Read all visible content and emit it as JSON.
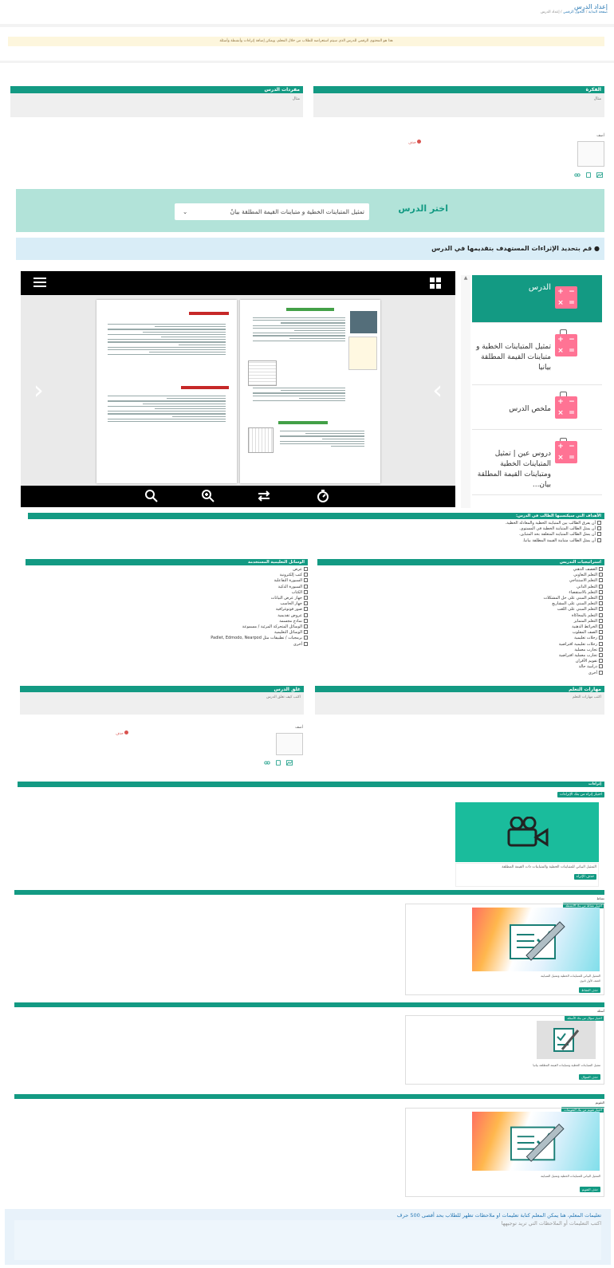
{
  "header": {
    "title": "إعداد الدرس",
    "breadcrumb": [
      "صفحة البداية",
      "التحول الرقمي",
      "إعداد الدرس"
    ]
  },
  "notice": {
    "text": "هذا هو المحتوى الرقمي للدرس الذي سيتم استعراضه للطلاب من خلال المعلم، ويمكن إضافة إثراءات وأنشطة وأسئلة"
  },
  "panels_top": {
    "left": {
      "title": "مفردات الدرس",
      "placeholder": "مثال"
    },
    "right": {
      "title": "الفكرة",
      "placeholder": "مثال"
    }
  },
  "attachment_top": {
    "label": "أضف",
    "delete": "حذف"
  },
  "lesson_select": {
    "label": "اختر الدرس",
    "value": "تمثيل المتباينات الخطية و متباينات القيمة المطلقة بيانً"
  },
  "enrichment_info": {
    "text": "قم بتحديد الإثراءات المستهدف بتقديمها في الدرس"
  },
  "sidebar": {
    "items": [
      {
        "label": "الدرس",
        "active": true
      },
      {
        "label": "تمثيل المتباينات الخطية و متباينات القيمة المطلقة بيانيا"
      },
      {
        "label": "ملخص الدرس"
      },
      {
        "label": "دروس عين | تمثيل المتباينات الخطية ومتباينات القيمة المطلقة بيان..."
      }
    ]
  },
  "goals": {
    "title": "الأهداف التي سيكتسبها الطالب في الدرس:",
    "items": [
      "أن يفرق الطالب بين المتباينة الخطية والمعادلة الخطية.",
      "أن يمثل الطالب المتباينة الخطية في المستوى.",
      "أن يمثل الطالب المتباينة المتعلقة بحد المتباين.",
      "أن يمثل الطالب متباينة القيمة المطلقة بيانيا."
    ]
  },
  "strategies": {
    "title": "استراتيجيات التدريس",
    "items": [
      "العصف الذهني",
      "التعلم التعاوني",
      "التعلم الاستنتاجي",
      "التعلم الذاتي",
      "التعلم بالاستقصاء",
      "التعلم المبني على حل المشكلات",
      "التعلم المبني على المشاريع",
      "التعلم المبني على اللعب",
      "التعلم بالمحاكاة",
      "التعلم المتمايز",
      "الخرائط الذهنية",
      "الصف المقلوب",
      "رحلات تعليمية",
      "رحلات تعليمية افتراضية",
      "تجارب معملية",
      "تجارب معملية افتراضية",
      "تقويم الأقران",
      "دراسة حالة",
      "أخرى"
    ]
  },
  "tools": {
    "title": "الوسائل التعليمية المستخدمة",
    "items": [
      "عرض",
      "كتب إلكترونية",
      "السبورة التفاعلية",
      "السبورة الذكية",
      "الكتاب",
      "جهاز عرض البيانات",
      "جهاز الحاسب",
      "صور فوتوغرافية",
      "عروض تقديمية",
      "نماذج مجسمة",
      "الوسائل المتحركة المرئية / مسموعة",
      "الوسائل التعليمية",
      "برمجيات / تطبيقات مثل Padlet, Edmodo, Nearpod",
      "أخرى"
    ]
  },
  "panels_bottom": {
    "left": {
      "title": "غلق الدرس",
      "placeholder": "اكتب كيف تغلق الدرس"
    },
    "right": {
      "title": "مهارات التعلم",
      "placeholder": "اكتب مهارات التعلم"
    }
  },
  "attachment_bottom": {
    "label": "أضف",
    "delete": "حذف"
  },
  "enrichment_section": {
    "title": "إثراءات",
    "button": "اختيار إثراء من بنك الإثراءات",
    "video_caption": "التمثيل البياني للمتباينات الخطية والمتباينات ذات القيمة المطلقة",
    "video_button": "حذف الإثراء"
  },
  "activities_section": {
    "title": "نشاط",
    "button": "اختيار نشاط من بنك الأنشطة",
    "caption": "التمثيل البياني للمتباينات الخطية وتمثيل المتباينة",
    "meta": "الصف الأول ثانوي",
    "remove": "حذف النشاط"
  },
  "questions_section": {
    "title": "أسئلة",
    "button": "اختيار سؤال من بنك الأسئلة",
    "caption": "تمثيل المتباينات الخطية ومتباينات القيمة المطلقة بيانيا",
    "remove": "حذف السؤال"
  },
  "assessment_section": {
    "title": "التقويم",
    "button": "اختيار تقويم من بنك التقويمات",
    "caption": "التمثيل البياني للمتباينات الخطية وتمثيل المتباينة",
    "remove": "حذف التقويم"
  },
  "teacher_notes": {
    "label": "تعليمات المعلم، هنا يمكن المعلم كتابة تعليمات او ملاحظات تظهر للطلاب بحد أقصى 500 حرف",
    "placeholder": "اكتب التعليمات أو الملاحظات التي تريد توجيهها"
  },
  "colors": {
    "teal": "#139a83",
    "pink": "#ff7394",
    "light_teal": "#b2e3d9",
    "info_blue": "#d9edf7"
  }
}
